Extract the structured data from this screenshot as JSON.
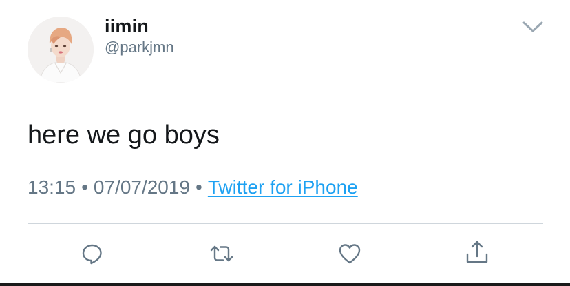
{
  "tweet": {
    "display_name": "iimin",
    "handle": "@parkjmn",
    "text": "here we go boys",
    "time": "13:15",
    "separator": "•",
    "date": "07/07/2019",
    "source": "Twitter for iPhone"
  },
  "icons": {
    "more": "chevron-down-icon",
    "reply": "reply-icon",
    "retweet": "retweet-icon",
    "like": "heart-icon",
    "share": "share-icon"
  },
  "colors": {
    "text": "#14171a",
    "secondary": "#657786",
    "link": "#1da1f2",
    "divider": "#cfd6dc",
    "icon": "#657786"
  }
}
